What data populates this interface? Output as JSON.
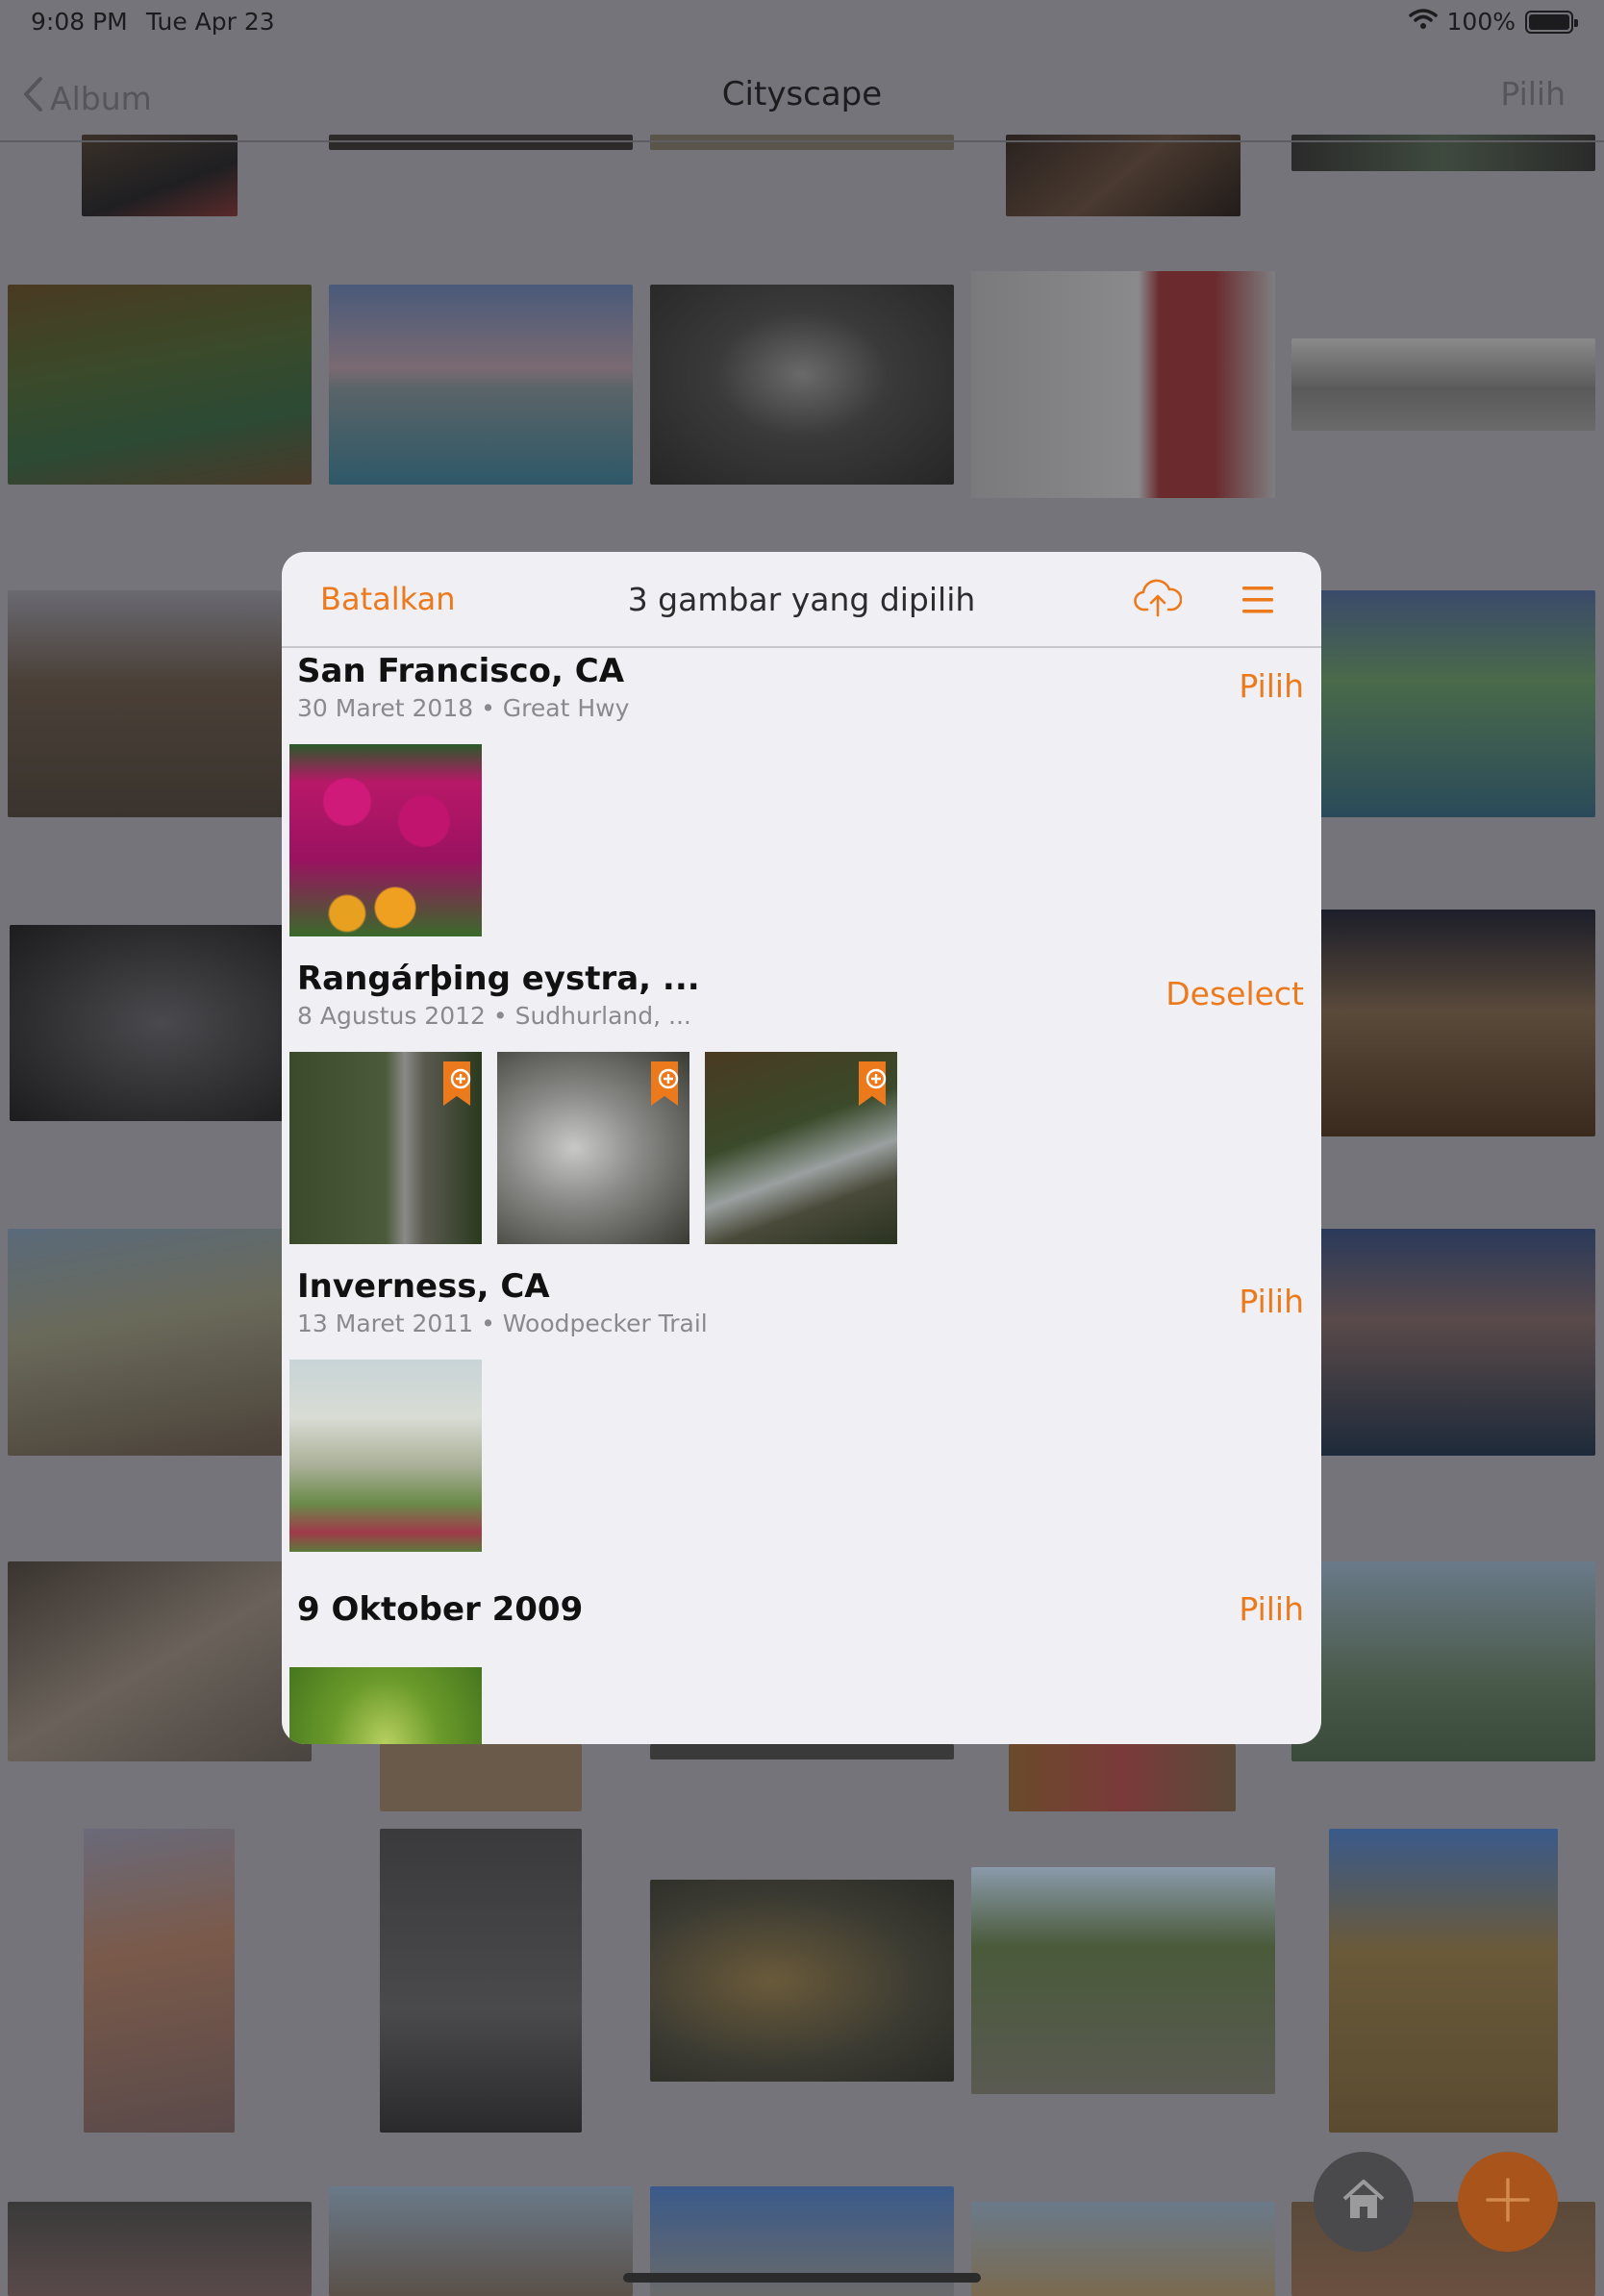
{
  "status_bar": {
    "time": "9:08 PM",
    "date": "Tue Apr 23",
    "battery": "100%"
  },
  "nav": {
    "back_label": "Album",
    "title": "Cityscape",
    "select_label": "Pilih"
  },
  "modal": {
    "cancel_label": "Batalkan",
    "title": "3 gambar yang dipilih",
    "groups": [
      {
        "title": "San Francisco, CA",
        "subtitle": "30 Maret 2018 • Great Hwy",
        "action": "Pilih"
      },
      {
        "title": "Rangárþing eystra, ...",
        "subtitle": "8 Agustus 2012 • Sudhurland, ...",
        "action": "Deselect"
      },
      {
        "title": "Inverness, CA",
        "subtitle": "13 Maret 2011 • Woodpecker Trail",
        "action": "Pilih"
      },
      {
        "title": "9 Oktober 2009",
        "subtitle": "",
        "action": "Pilih"
      }
    ]
  },
  "colors": {
    "accent": "#ec7a1c",
    "dim_overlay": "#74747a"
  },
  "icons": [
    "chevron-left-icon",
    "wifi-icon",
    "battery-icon",
    "cloud-upload-icon",
    "menu-icon",
    "bookmark-add-icon",
    "home-icon",
    "plus-icon"
  ]
}
